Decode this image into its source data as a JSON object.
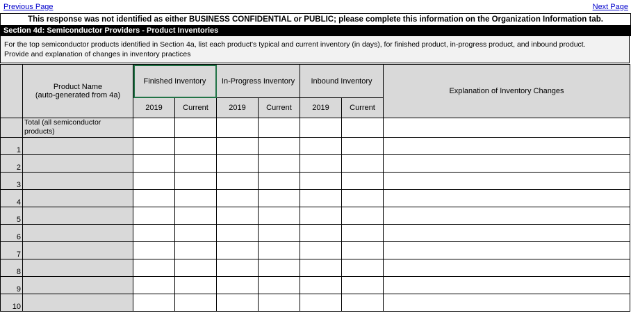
{
  "nav": {
    "previous": "Previous Page",
    "next": "Next Page"
  },
  "notice": "This response was not identified as either BUSINESS CONFIDENTIAL or PUBLIC; please complete this information on the Organization Information tab.",
  "section_title": "Section 4d: Semiconductor Providers - Product Inventories",
  "instructions": {
    "line1": "For the top semiconductor products identified in Section 4a, list each product's typical and current inventory (in days), for finished product, in-progress product, and inbound product.",
    "line2": "Provide and explanation of changes in inventory practices"
  },
  "table": {
    "product_name_header_line1": "Product Name",
    "product_name_header_line2": "(auto-generated from 4a)",
    "groups": [
      "Finished Inventory",
      "In-Progress Inventory",
      "Inbound Inventory"
    ],
    "subheaders": [
      "2019",
      "Current",
      "2019",
      "Current",
      "2019",
      "Current"
    ],
    "explanation_header": "Explanation of Inventory Changes",
    "total_label": "Total (all semiconductor products)",
    "row_numbers": [
      "1",
      "2",
      "3",
      "4",
      "5",
      "6",
      "7",
      "8",
      "9",
      "10"
    ]
  }
}
